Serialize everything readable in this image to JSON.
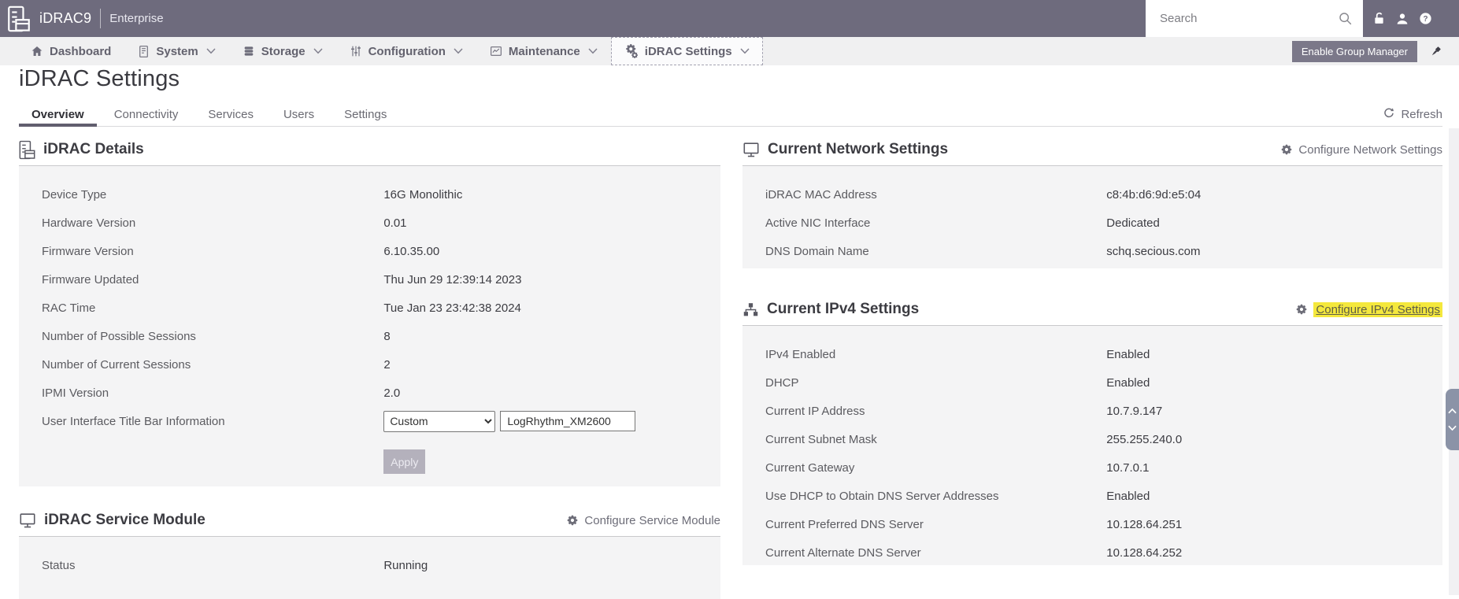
{
  "colors": {
    "topbar_bg": "#6e6b7d",
    "nav_bg": "#f0f0f1",
    "card_body_bg": "#f4f4f5",
    "highlight_yellow": "#f4e83d",
    "apply_disabled_bg": "#b4b1bc"
  },
  "topbar": {
    "product": "iDRAC9",
    "edition": "Enterprise",
    "search_placeholder": "Search"
  },
  "nav": {
    "items": [
      {
        "label": "Dashboard"
      },
      {
        "label": "System"
      },
      {
        "label": "Storage"
      },
      {
        "label": "Configuration"
      },
      {
        "label": "Maintenance"
      },
      {
        "label": "iDRAC Settings"
      }
    ],
    "enable_group_manager_label": "Enable Group Manager"
  },
  "page": {
    "title": "iDRAC Settings",
    "tabs": [
      "Overview",
      "Connectivity",
      "Services",
      "Users",
      "Settings"
    ],
    "active_tab": "Overview",
    "refresh_label": "Refresh"
  },
  "idrac_details": {
    "title": "iDRAC Details",
    "rows": [
      {
        "label": "Device Type",
        "value": "16G Monolithic"
      },
      {
        "label": "Hardware Version",
        "value": "0.01"
      },
      {
        "label": "Firmware Version",
        "value": "6.10.35.00"
      },
      {
        "label": "Firmware Updated",
        "value": "Thu Jun 29 12:39:14 2023"
      },
      {
        "label": "RAC Time",
        "value": "Tue Jan 23 23:42:38 2024"
      },
      {
        "label": "Number of Possible Sessions",
        "value": "8"
      },
      {
        "label": "Number of Current Sessions",
        "value": "2"
      },
      {
        "label": "IPMI Version",
        "value": "2.0"
      }
    ],
    "title_bar": {
      "label": "User Interface Title Bar Information",
      "select_value": "Custom",
      "input_value": "LogRhythm_XM2600"
    },
    "apply_label": "Apply"
  },
  "service_module": {
    "title": "iDRAC Service Module",
    "action_label": "Configure Service Module",
    "rows": [
      {
        "label": "Status",
        "value": "Running"
      }
    ]
  },
  "network_settings": {
    "title": "Current Network Settings",
    "action_label": "Configure Network Settings",
    "rows": [
      {
        "label": "iDRAC MAC Address",
        "value": "c8:4b:d6:9d:e5:04"
      },
      {
        "label": "Active NIC Interface",
        "value": "Dedicated"
      },
      {
        "label": "DNS Domain Name",
        "value": "schq.secious.com"
      }
    ]
  },
  "ipv4_settings": {
    "title": "Current IPv4 Settings",
    "action_label": "Configure IPv4 Settings",
    "action_highlighted": true,
    "rows": [
      {
        "label": "IPv4 Enabled",
        "value": "Enabled"
      },
      {
        "label": "DHCP",
        "value": "Enabled"
      },
      {
        "label": "Current IP Address",
        "value": "10.7.9.147"
      },
      {
        "label": "Current Subnet Mask",
        "value": "255.255.240.0"
      },
      {
        "label": "Current Gateway",
        "value": "10.7.0.1"
      },
      {
        "label": "Use DHCP to Obtain DNS Server Addresses",
        "value": "Enabled"
      },
      {
        "label": "Current Preferred DNS Server",
        "value": "10.128.64.251"
      },
      {
        "label": "Current Alternate DNS Server",
        "value": "10.128.64.252"
      }
    ]
  }
}
